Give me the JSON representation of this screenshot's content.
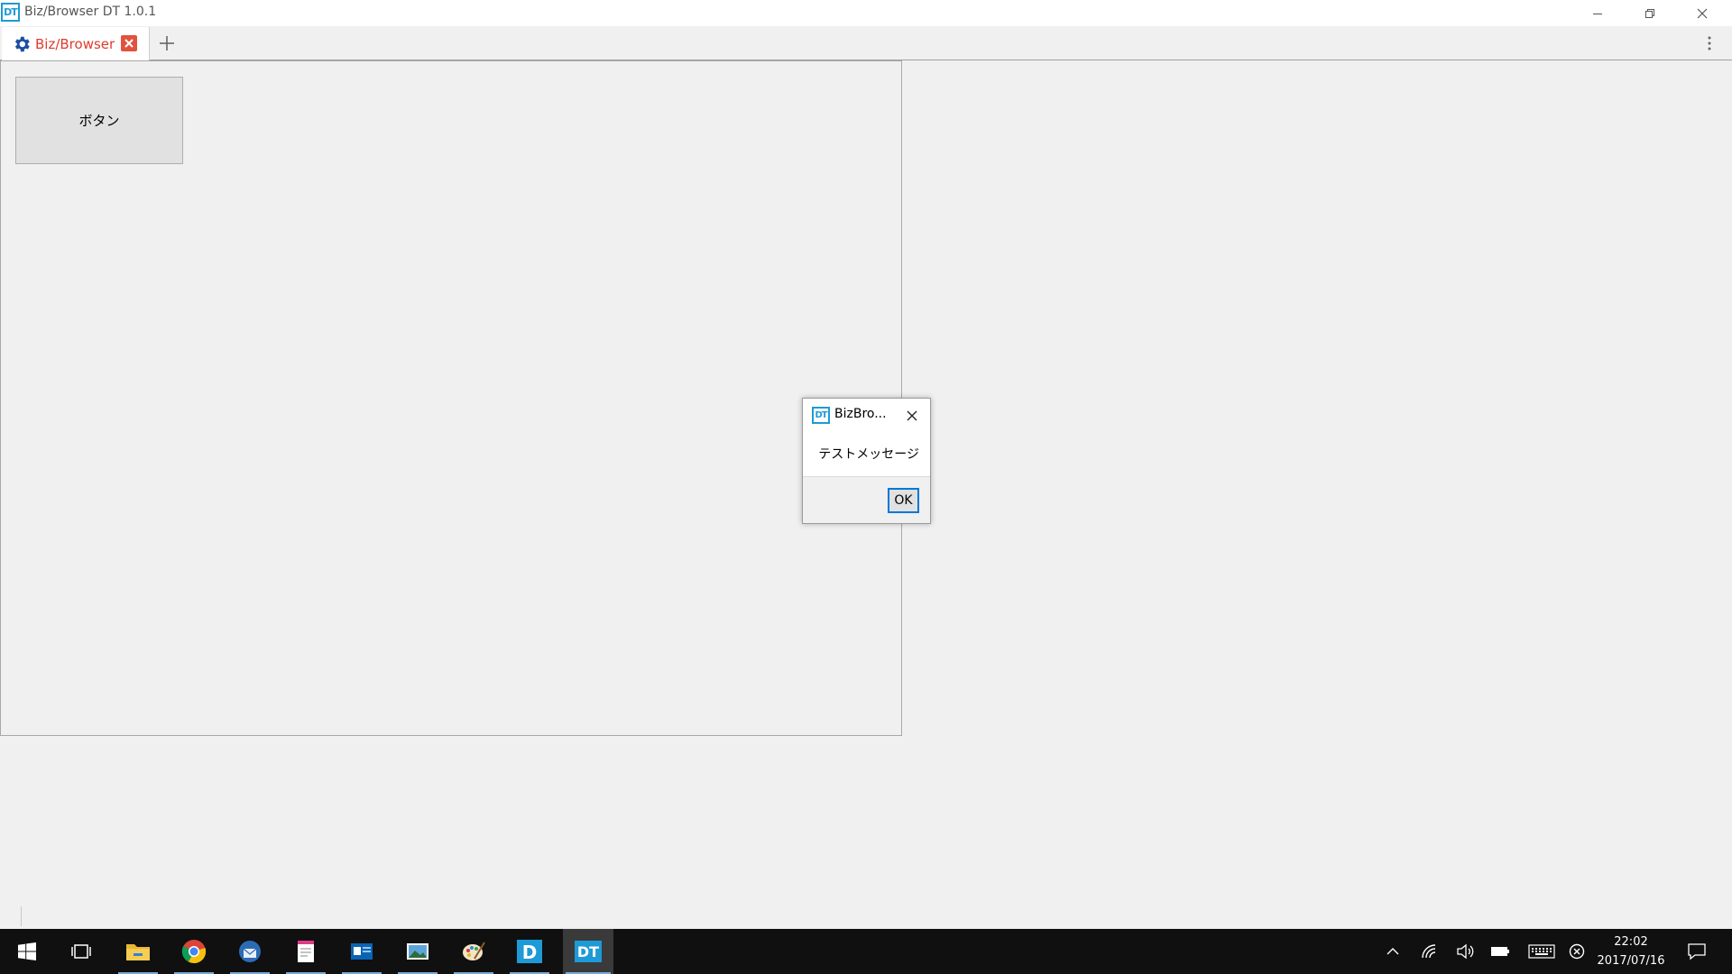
{
  "window": {
    "title": "Biz/Browser DT 1.0.1",
    "icon_text": "DT",
    "accent": "#1e9ad6"
  },
  "tabs": [
    {
      "label": "Biz/Browser",
      "icon": "gear-icon",
      "color": "#e03a2e",
      "active": true
    }
  ],
  "content": {
    "button_label": "ボタン"
  },
  "dialog": {
    "title": "BizBro...",
    "icon_text": "DT",
    "message": "テストメッセージ",
    "ok_label": "OK"
  },
  "taskbar": {
    "apps": [
      "start-icon",
      "task-view-icon",
      "file-explorer-icon",
      "chrome-icon",
      "thunderbird-icon",
      "notepad-icon",
      "outlook-icon",
      "photos-icon",
      "paint-icon",
      "bizdesigner-icon",
      "biz-browser-dt-icon"
    ],
    "tray": [
      "chevron-up-icon",
      "wifi-icon",
      "volume-icon",
      "battery-icon",
      "keyboard-icon",
      "error-icon"
    ],
    "time": "22:02",
    "date": "2017/07/16"
  }
}
